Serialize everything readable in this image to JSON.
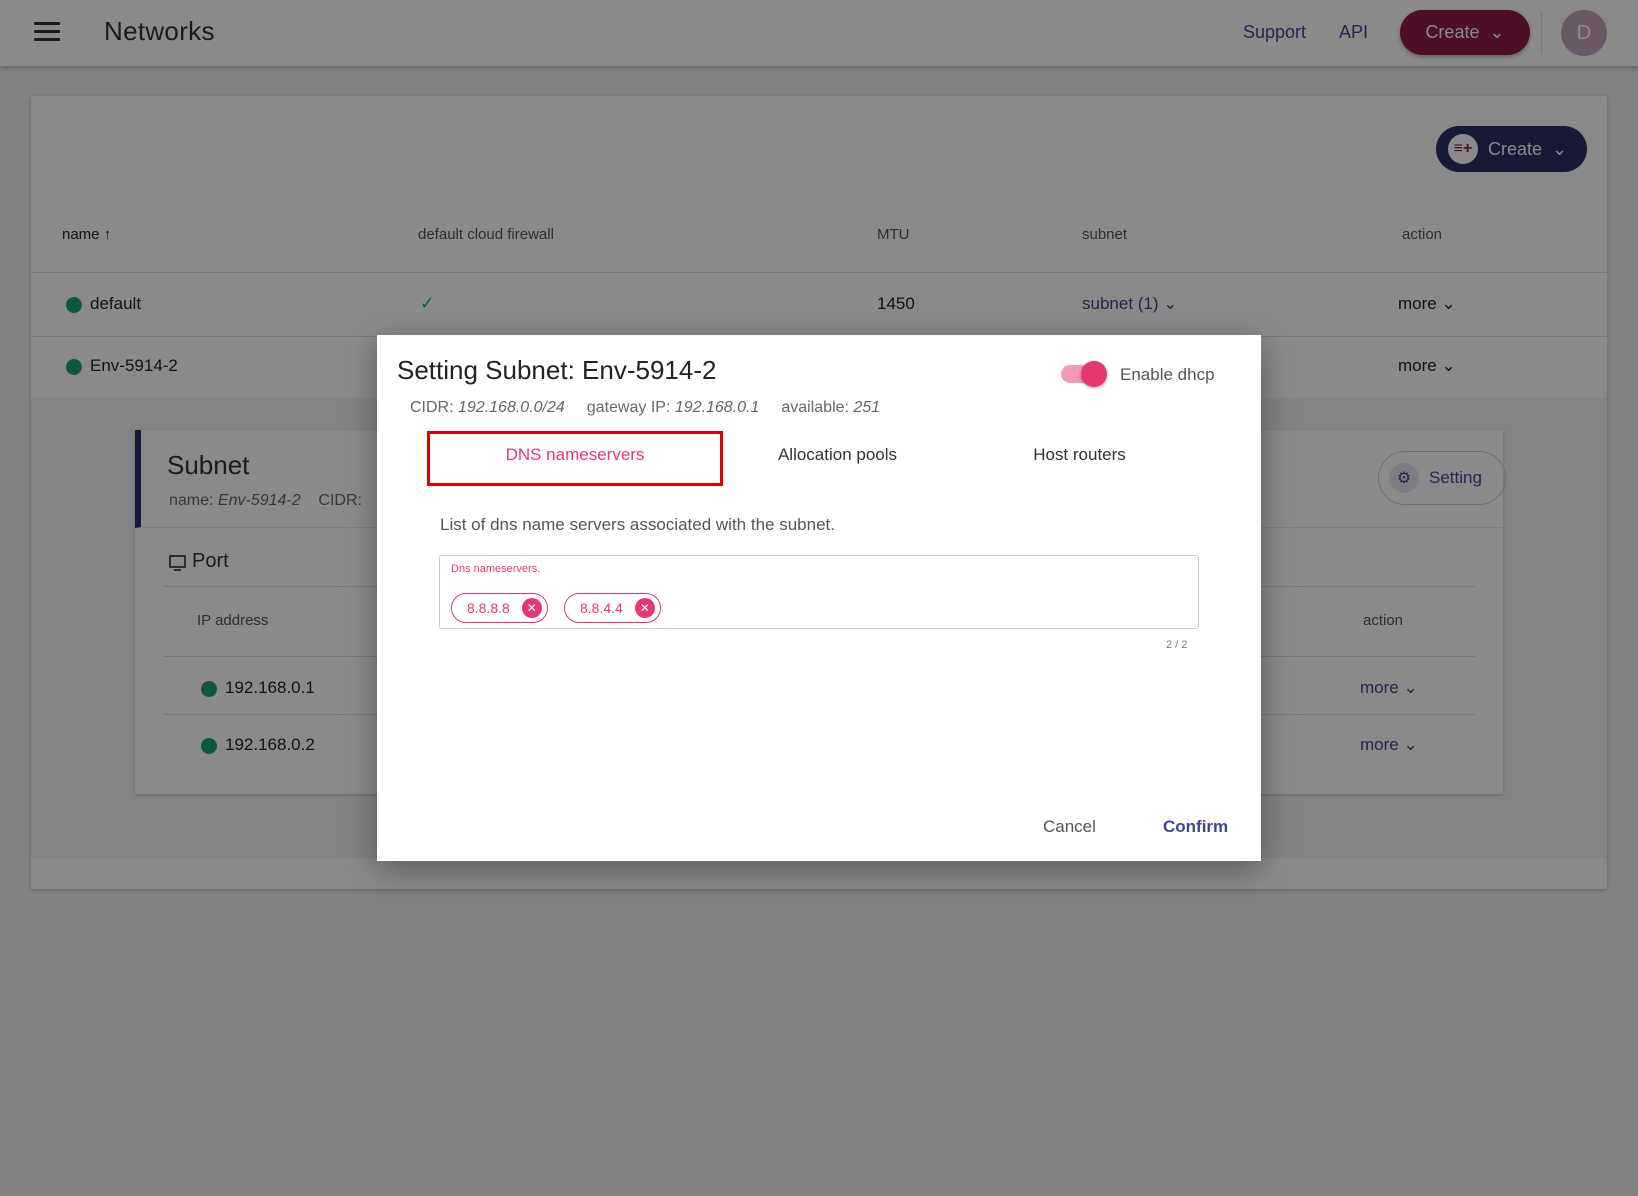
{
  "header": {
    "title": "Networks",
    "support": "Support",
    "api": "API",
    "create": "Create",
    "avatar_initial": "D"
  },
  "networks": {
    "create": "Create",
    "columns": [
      "name",
      "default cloud firewall",
      "MTU",
      "subnet",
      "action"
    ],
    "rows": [
      {
        "name": "default",
        "firewall": "✓",
        "mtu": "1450",
        "subnet": "subnet (1)",
        "action": "more"
      },
      {
        "name": "Env-5914-2",
        "action": "more"
      }
    ]
  },
  "subnet": {
    "title": "Subnet",
    "name_label": "name:",
    "name_value": "Env-5914-2",
    "cidr_label": "CIDR:",
    "setting": "Setting",
    "port": {
      "title": "Port",
      "columns": {
        "ip": "IP address",
        "action": "action"
      },
      "rows": [
        {
          "ip": "192.168.0.1",
          "action": "more"
        },
        {
          "ip": "192.168.0.2",
          "action": "more"
        }
      ]
    }
  },
  "dialog": {
    "title": "Setting Subnet: Env-5914-2",
    "cidr_label": "CIDR:",
    "cidr": "192.168.0.0/24",
    "gateway_label": "gateway IP:",
    "gateway": "192.168.0.1",
    "available_label": "available:",
    "available": "251",
    "dhcp_label": "Enable dhcp",
    "dhcp_enabled": true,
    "tabs": [
      "DNS nameservers",
      "Allocation pools",
      "Host routers"
    ],
    "active_tab": "DNS nameservers",
    "description": "List of dns name servers associated with the subnet.",
    "field_label": "Dns nameservers.",
    "chips": [
      "8.8.8.8",
      "8.8.4.4"
    ],
    "counter": "2 / 2",
    "cancel": "Cancel",
    "confirm": "Confirm"
  }
}
